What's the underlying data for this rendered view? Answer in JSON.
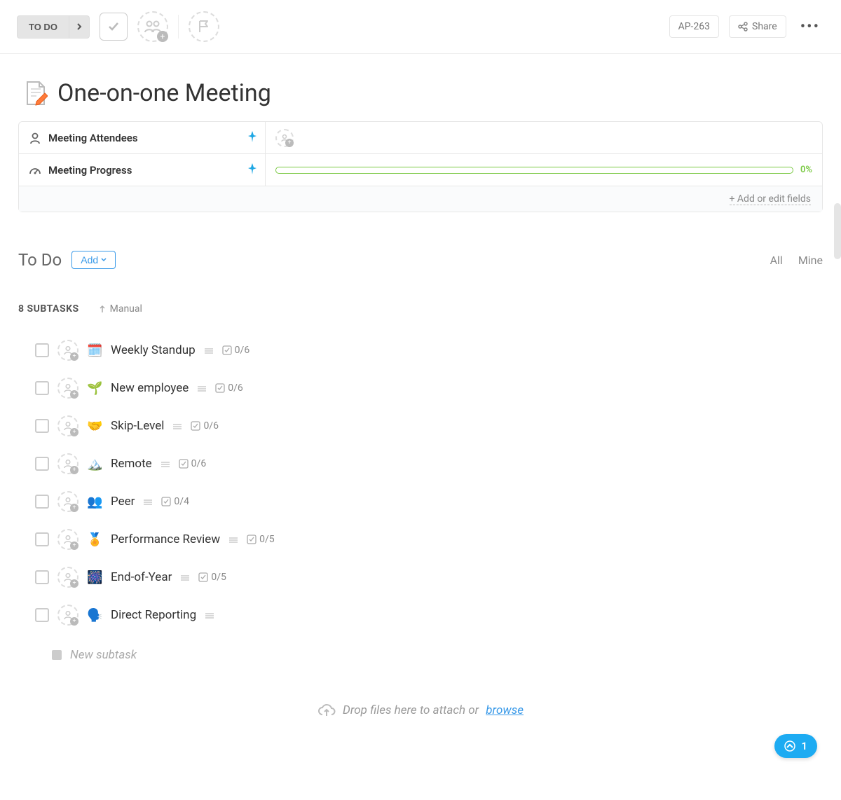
{
  "topbar": {
    "status_label": "TO DO",
    "task_id": "AP-263",
    "share_label": "Share"
  },
  "title": "One-on-one Meeting",
  "fields": {
    "attendees_label": "Meeting Attendees",
    "progress_label": "Meeting Progress",
    "progress_pct": "0%",
    "add_edit_label": "+ Add or edit fields"
  },
  "section": {
    "title": "To Do",
    "add_label": "Add",
    "filter_all": "All",
    "filter_mine": "Mine"
  },
  "subtasks_meta": {
    "count_label": "8 SUBTASKS",
    "sort_label": "Manual"
  },
  "subtasks": [
    {
      "emoji": "🗓️",
      "name": "Weekly Standup",
      "count": "0/6"
    },
    {
      "emoji": "🌱",
      "name": "New employee",
      "count": "0/6"
    },
    {
      "emoji": "🤝",
      "name": "Skip-Level",
      "count": "0/6"
    },
    {
      "emoji": "🏔️",
      "name": "Remote",
      "count": "0/6"
    },
    {
      "emoji": "👥",
      "name": "Peer",
      "count": "0/4"
    },
    {
      "emoji": "🏅",
      "name": "Performance Review",
      "count": "0/5"
    },
    {
      "emoji": "🎆",
      "name": "End-of-Year",
      "count": "0/5"
    },
    {
      "emoji": "🗣️",
      "name": "Direct Reporting",
      "count": ""
    }
  ],
  "new_subtask_placeholder": "New subtask",
  "drop": {
    "text": "Drop files here to attach or ",
    "link": "browse"
  },
  "fab": {
    "count": "1"
  }
}
